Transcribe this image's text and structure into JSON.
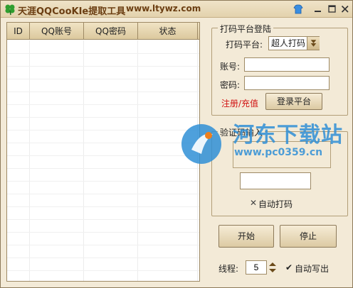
{
  "titlebar": {
    "title": "天涯QQCooKIe提取工具",
    "url": "www.ltywz.com"
  },
  "table": {
    "columns": [
      "ID",
      "QQ账号",
      "QQ密码",
      "状态"
    ],
    "rows": []
  },
  "login_group": {
    "legend": "打码平台登陆",
    "platform_label": "打码平台:",
    "platform_value": "超人打码",
    "account_label": "账号:",
    "account_value": "",
    "password_label": "密码:",
    "password_value": "",
    "register_link": "注册/充值",
    "login_button": "登录平台"
  },
  "captcha_group": {
    "legend": "验证码输入",
    "input_value": "",
    "auto_label": "自动打码",
    "auto_mark": "✕"
  },
  "actions": {
    "start": "开始",
    "stop": "停止"
  },
  "threads": {
    "label": "线程:",
    "value": "5",
    "auto_write_label": "自动写出",
    "auto_write_mark": "✔"
  },
  "watermark": {
    "text": "河东下载站",
    "url": "www.pc0359.cn"
  },
  "colors": {
    "window_bg": "#f3ead7",
    "title_text": "#6b3e12",
    "link_red": "#d01010",
    "watermark_blue": "#2f8fd6"
  },
  "icons": [
    "clover-icon",
    "skin-shirt-icon",
    "minimize-icon",
    "maximize-icon",
    "close-icon",
    "dropdown-arrow-icon",
    "spinner-arrows-icon"
  ]
}
